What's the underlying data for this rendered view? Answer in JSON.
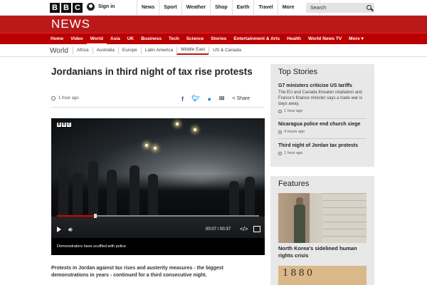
{
  "topbar": {
    "logo_letters": [
      "B",
      "B",
      "C"
    ],
    "sign_in": "Sign in",
    "nav": [
      "News",
      "Sport",
      "Weather",
      "Shop",
      "Earth",
      "Travel",
      "More"
    ],
    "search_placeholder": "Search"
  },
  "masthead": {
    "title": "NEWS",
    "color": "#bb1919"
  },
  "main_nav": {
    "items": [
      "Home",
      "Video",
      "World",
      "Asia",
      "UK",
      "Business",
      "Tech",
      "Science",
      "Stories",
      "Entertainment & Arts",
      "Health",
      "World News TV",
      "More ▾"
    ],
    "active": "World"
  },
  "sub_nav": {
    "section": "World",
    "items": [
      "Africa",
      "Australia",
      "Europe",
      "Latin America",
      "Middle East",
      "US & Canada"
    ],
    "active": "Middle East"
  },
  "article": {
    "headline": "Jordanians in third night of tax rise protests",
    "time": "1 hour ago",
    "share_label": "Share",
    "video": {
      "logo_letters": [
        "B",
        "B",
        "C"
      ],
      "time": "00:07 / 00:37",
      "progress_fraction": 0.19,
      "caption": "Demonstrators have scuffled with police"
    },
    "intro": "Protests in Jordan against tax rises and austerity measures - the biggest demonstrations in years - continued for a third consecutive night."
  },
  "top_stories": {
    "title": "Top Stories",
    "stories": [
      {
        "title": "G7 ministers criticise US tariffs",
        "summary": "The EU and Canada threaten retaliation and France's finance minister says a trade war is days away.",
        "time": "1 hour ago"
      },
      {
        "title": "Nicaragua police end church siege",
        "time": "4 hours ago"
      },
      {
        "title": "Third night of Jordan tax protests",
        "time": "1 hour ago"
      }
    ]
  },
  "features": {
    "title": "Features",
    "items": [
      {
        "title": "North Korea's sidelined human rights crisis"
      },
      {
        "image_text": "1880"
      }
    ]
  }
}
